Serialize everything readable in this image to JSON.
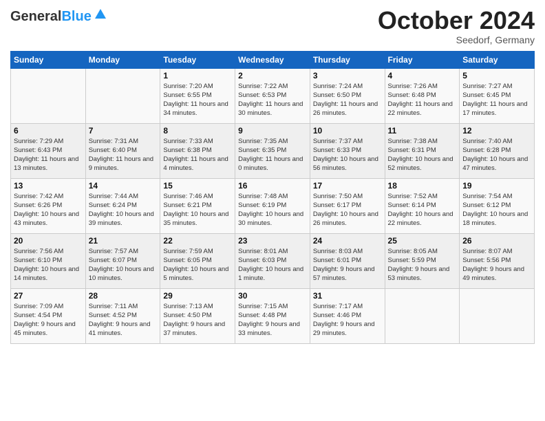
{
  "header": {
    "logo_line1": "General",
    "logo_blue": "Blue",
    "month_title": "October 2024",
    "subtitle": "Seedorf, Germany"
  },
  "days_of_week": [
    "Sunday",
    "Monday",
    "Tuesday",
    "Wednesday",
    "Thursday",
    "Friday",
    "Saturday"
  ],
  "weeks": [
    [
      {
        "day": "",
        "info": ""
      },
      {
        "day": "",
        "info": ""
      },
      {
        "day": "1",
        "info": "Sunrise: 7:20 AM\nSunset: 6:55 PM\nDaylight: 11 hours and 34 minutes."
      },
      {
        "day": "2",
        "info": "Sunrise: 7:22 AM\nSunset: 6:53 PM\nDaylight: 11 hours and 30 minutes."
      },
      {
        "day": "3",
        "info": "Sunrise: 7:24 AM\nSunset: 6:50 PM\nDaylight: 11 hours and 26 minutes."
      },
      {
        "day": "4",
        "info": "Sunrise: 7:26 AM\nSunset: 6:48 PM\nDaylight: 11 hours and 22 minutes."
      },
      {
        "day": "5",
        "info": "Sunrise: 7:27 AM\nSunset: 6:45 PM\nDaylight: 11 hours and 17 minutes."
      }
    ],
    [
      {
        "day": "6",
        "info": "Sunrise: 7:29 AM\nSunset: 6:43 PM\nDaylight: 11 hours and 13 minutes."
      },
      {
        "day": "7",
        "info": "Sunrise: 7:31 AM\nSunset: 6:40 PM\nDaylight: 11 hours and 9 minutes."
      },
      {
        "day": "8",
        "info": "Sunrise: 7:33 AM\nSunset: 6:38 PM\nDaylight: 11 hours and 4 minutes."
      },
      {
        "day": "9",
        "info": "Sunrise: 7:35 AM\nSunset: 6:35 PM\nDaylight: 11 hours and 0 minutes."
      },
      {
        "day": "10",
        "info": "Sunrise: 7:37 AM\nSunset: 6:33 PM\nDaylight: 10 hours and 56 minutes."
      },
      {
        "day": "11",
        "info": "Sunrise: 7:38 AM\nSunset: 6:31 PM\nDaylight: 10 hours and 52 minutes."
      },
      {
        "day": "12",
        "info": "Sunrise: 7:40 AM\nSunset: 6:28 PM\nDaylight: 10 hours and 47 minutes."
      }
    ],
    [
      {
        "day": "13",
        "info": "Sunrise: 7:42 AM\nSunset: 6:26 PM\nDaylight: 10 hours and 43 minutes."
      },
      {
        "day": "14",
        "info": "Sunrise: 7:44 AM\nSunset: 6:24 PM\nDaylight: 10 hours and 39 minutes."
      },
      {
        "day": "15",
        "info": "Sunrise: 7:46 AM\nSunset: 6:21 PM\nDaylight: 10 hours and 35 minutes."
      },
      {
        "day": "16",
        "info": "Sunrise: 7:48 AM\nSunset: 6:19 PM\nDaylight: 10 hours and 30 minutes."
      },
      {
        "day": "17",
        "info": "Sunrise: 7:50 AM\nSunset: 6:17 PM\nDaylight: 10 hours and 26 minutes."
      },
      {
        "day": "18",
        "info": "Sunrise: 7:52 AM\nSunset: 6:14 PM\nDaylight: 10 hours and 22 minutes."
      },
      {
        "day": "19",
        "info": "Sunrise: 7:54 AM\nSunset: 6:12 PM\nDaylight: 10 hours and 18 minutes."
      }
    ],
    [
      {
        "day": "20",
        "info": "Sunrise: 7:56 AM\nSunset: 6:10 PM\nDaylight: 10 hours and 14 minutes."
      },
      {
        "day": "21",
        "info": "Sunrise: 7:57 AM\nSunset: 6:07 PM\nDaylight: 10 hours and 10 minutes."
      },
      {
        "day": "22",
        "info": "Sunrise: 7:59 AM\nSunset: 6:05 PM\nDaylight: 10 hours and 5 minutes."
      },
      {
        "day": "23",
        "info": "Sunrise: 8:01 AM\nSunset: 6:03 PM\nDaylight: 10 hours and 1 minute."
      },
      {
        "day": "24",
        "info": "Sunrise: 8:03 AM\nSunset: 6:01 PM\nDaylight: 9 hours and 57 minutes."
      },
      {
        "day": "25",
        "info": "Sunrise: 8:05 AM\nSunset: 5:59 PM\nDaylight: 9 hours and 53 minutes."
      },
      {
        "day": "26",
        "info": "Sunrise: 8:07 AM\nSunset: 5:56 PM\nDaylight: 9 hours and 49 minutes."
      }
    ],
    [
      {
        "day": "27",
        "info": "Sunrise: 7:09 AM\nSunset: 4:54 PM\nDaylight: 9 hours and 45 minutes."
      },
      {
        "day": "28",
        "info": "Sunrise: 7:11 AM\nSunset: 4:52 PM\nDaylight: 9 hours and 41 minutes."
      },
      {
        "day": "29",
        "info": "Sunrise: 7:13 AM\nSunset: 4:50 PM\nDaylight: 9 hours and 37 minutes."
      },
      {
        "day": "30",
        "info": "Sunrise: 7:15 AM\nSunset: 4:48 PM\nDaylight: 9 hours and 33 minutes."
      },
      {
        "day": "31",
        "info": "Sunrise: 7:17 AM\nSunset: 4:46 PM\nDaylight: 9 hours and 29 minutes."
      },
      {
        "day": "",
        "info": ""
      },
      {
        "day": "",
        "info": ""
      }
    ]
  ]
}
